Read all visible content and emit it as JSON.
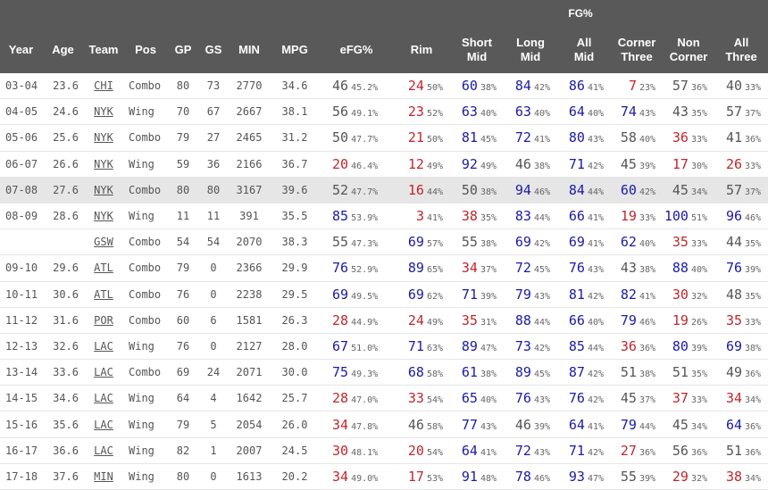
{
  "header": {
    "group_label": "FG%",
    "columns": [
      "Year",
      "Age",
      "Team",
      "Pos",
      "GP",
      "GS",
      "MIN",
      "MPG",
      "eFG%",
      "Rim",
      "Short\nMid",
      "Long\nMid",
      "All\nMid",
      "Corner\nThree",
      "Non\nCorner",
      "All\nThree"
    ]
  },
  "colors": {
    "high": "#1a1aa6",
    "low": "#c0262c",
    "mid": "#555555",
    "header_bg": "#595959",
    "highlight_row": "#e6e6e6"
  },
  "rows": [
    {
      "year": "03-04",
      "age": "23.6",
      "team": "CHI",
      "pos": "Combo",
      "gp": "80",
      "gs": "73",
      "min": "2770",
      "mpg": "34.6",
      "efg": [
        "46",
        "45.2%"
      ],
      "rim": [
        "24",
        "50%"
      ],
      "short_mid": [
        "60",
        "38%"
      ],
      "long_mid": [
        "84",
        "42%"
      ],
      "all_mid": [
        "86",
        "41%"
      ],
      "corner3": [
        "7",
        "23%"
      ],
      "noncorner": [
        "57",
        "36%"
      ],
      "all3": [
        "40",
        "33%"
      ]
    },
    {
      "year": "04-05",
      "age": "24.6",
      "team": "NYK",
      "pos": "Wing",
      "gp": "70",
      "gs": "67",
      "min": "2667",
      "mpg": "38.1",
      "efg": [
        "56",
        "49.1%"
      ],
      "rim": [
        "23",
        "52%"
      ],
      "short_mid": [
        "63",
        "40%"
      ],
      "long_mid": [
        "63",
        "40%"
      ],
      "all_mid": [
        "64",
        "40%"
      ],
      "corner3": [
        "74",
        "43%"
      ],
      "noncorner": [
        "43",
        "35%"
      ],
      "all3": [
        "57",
        "37%"
      ]
    },
    {
      "year": "05-06",
      "age": "25.6",
      "team": "NYK",
      "pos": "Combo",
      "gp": "79",
      "gs": "27",
      "min": "2465",
      "mpg": "31.2",
      "efg": [
        "50",
        "47.7%"
      ],
      "rim": [
        "21",
        "50%"
      ],
      "short_mid": [
        "81",
        "45%"
      ],
      "long_mid": [
        "72",
        "41%"
      ],
      "all_mid": [
        "80",
        "43%"
      ],
      "corner3": [
        "58",
        "40%"
      ],
      "noncorner": [
        "36",
        "33%"
      ],
      "all3": [
        "41",
        "36%"
      ]
    },
    {
      "year": "06-07",
      "age": "26.6",
      "team": "NYK",
      "pos": "Wing",
      "gp": "59",
      "gs": "36",
      "min": "2166",
      "mpg": "36.7",
      "efg": [
        "20",
        "46.4%"
      ],
      "rim": [
        "12",
        "49%"
      ],
      "short_mid": [
        "92",
        "49%"
      ],
      "long_mid": [
        "46",
        "38%"
      ],
      "all_mid": [
        "71",
        "42%"
      ],
      "corner3": [
        "45",
        "39%"
      ],
      "noncorner": [
        "17",
        "30%"
      ],
      "all3": [
        "26",
        "33%"
      ]
    },
    {
      "year": "07-08",
      "age": "27.6",
      "team": "NYK",
      "pos": "Combo",
      "gp": "80",
      "gs": "80",
      "min": "3167",
      "mpg": "39.6",
      "efg": [
        "52",
        "47.7%"
      ],
      "rim": [
        "16",
        "44%"
      ],
      "short_mid": [
        "50",
        "38%"
      ],
      "long_mid": [
        "94",
        "46%"
      ],
      "all_mid": [
        "84",
        "44%"
      ],
      "corner3": [
        "60",
        "42%"
      ],
      "noncorner": [
        "45",
        "34%"
      ],
      "all3": [
        "57",
        "37%"
      ],
      "highlight": true
    },
    {
      "year": "08-09",
      "age": "28.6",
      "team": "NYK",
      "pos": "Wing",
      "gp": "11",
      "gs": "11",
      "min": "391",
      "mpg": "35.5",
      "efg": [
        "85",
        "53.9%"
      ],
      "rim": [
        "3",
        "41%"
      ],
      "short_mid": [
        "38",
        "35%"
      ],
      "long_mid": [
        "83",
        "44%"
      ],
      "all_mid": [
        "66",
        "41%"
      ],
      "corner3": [
        "19",
        "33%"
      ],
      "noncorner": [
        "100",
        "51%"
      ],
      "all3": [
        "96",
        "46%"
      ]
    },
    {
      "year": "",
      "age": "",
      "team": "GSW",
      "pos": "Combo",
      "gp": "54",
      "gs": "54",
      "min": "2070",
      "mpg": "38.3",
      "efg": [
        "55",
        "47.3%"
      ],
      "rim": [
        "69",
        "57%"
      ],
      "short_mid": [
        "55",
        "38%"
      ],
      "long_mid": [
        "69",
        "42%"
      ],
      "all_mid": [
        "69",
        "41%"
      ],
      "corner3": [
        "62",
        "40%"
      ],
      "noncorner": [
        "35",
        "33%"
      ],
      "all3": [
        "44",
        "35%"
      ]
    },
    {
      "year": "09-10",
      "age": "29.6",
      "team": "ATL",
      "pos": "Combo",
      "gp": "79",
      "gs": "0",
      "min": "2366",
      "mpg": "29.9",
      "efg": [
        "76",
        "52.9%"
      ],
      "rim": [
        "89",
        "65%"
      ],
      "short_mid": [
        "34",
        "37%"
      ],
      "long_mid": [
        "72",
        "45%"
      ],
      "all_mid": [
        "76",
        "43%"
      ],
      "corner3": [
        "43",
        "38%"
      ],
      "noncorner": [
        "88",
        "40%"
      ],
      "all3": [
        "76",
        "39%"
      ]
    },
    {
      "year": "10-11",
      "age": "30.6",
      "team": "ATL",
      "pos": "Combo",
      "gp": "76",
      "gs": "0",
      "min": "2238",
      "mpg": "29.5",
      "efg": [
        "69",
        "49.5%"
      ],
      "rim": [
        "69",
        "62%"
      ],
      "short_mid": [
        "71",
        "39%"
      ],
      "long_mid": [
        "79",
        "43%"
      ],
      "all_mid": [
        "81",
        "42%"
      ],
      "corner3": [
        "82",
        "41%"
      ],
      "noncorner": [
        "30",
        "32%"
      ],
      "all3": [
        "48",
        "35%"
      ]
    },
    {
      "year": "11-12",
      "age": "31.6",
      "team": "POR",
      "pos": "Combo",
      "gp": "60",
      "gs": "6",
      "min": "1581",
      "mpg": "26.3",
      "efg": [
        "28",
        "44.9%"
      ],
      "rim": [
        "24",
        "49%"
      ],
      "short_mid": [
        "35",
        "31%"
      ],
      "long_mid": [
        "88",
        "44%"
      ],
      "all_mid": [
        "66",
        "40%"
      ],
      "corner3": [
        "79",
        "46%"
      ],
      "noncorner": [
        "19",
        "26%"
      ],
      "all3": [
        "35",
        "33%"
      ]
    },
    {
      "year": "12-13",
      "age": "32.6",
      "team": "LAC",
      "pos": "Wing",
      "gp": "76",
      "gs": "0",
      "min": "2127",
      "mpg": "28.0",
      "efg": [
        "67",
        "51.0%"
      ],
      "rim": [
        "71",
        "63%"
      ],
      "short_mid": [
        "89",
        "47%"
      ],
      "long_mid": [
        "73",
        "42%"
      ],
      "all_mid": [
        "85",
        "44%"
      ],
      "corner3": [
        "36",
        "36%"
      ],
      "noncorner": [
        "80",
        "39%"
      ],
      "all3": [
        "69",
        "38%"
      ]
    },
    {
      "year": "13-14",
      "age": "33.6",
      "team": "LAC",
      "pos": "Combo",
      "gp": "69",
      "gs": "24",
      "min": "2071",
      "mpg": "30.0",
      "efg": [
        "75",
        "49.3%"
      ],
      "rim": [
        "68",
        "58%"
      ],
      "short_mid": [
        "61",
        "38%"
      ],
      "long_mid": [
        "89",
        "45%"
      ],
      "all_mid": [
        "87",
        "42%"
      ],
      "corner3": [
        "51",
        "38%"
      ],
      "noncorner": [
        "51",
        "35%"
      ],
      "all3": [
        "49",
        "36%"
      ]
    },
    {
      "year": "14-15",
      "age": "34.6",
      "team": "LAC",
      "pos": "Wing",
      "gp": "64",
      "gs": "4",
      "min": "1642",
      "mpg": "25.7",
      "efg": [
        "28",
        "47.0%"
      ],
      "rim": [
        "33",
        "54%"
      ],
      "short_mid": [
        "65",
        "40%"
      ],
      "long_mid": [
        "76",
        "43%"
      ],
      "all_mid": [
        "76",
        "42%"
      ],
      "corner3": [
        "45",
        "37%"
      ],
      "noncorner": [
        "37",
        "33%"
      ],
      "all3": [
        "34",
        "34%"
      ]
    },
    {
      "year": "15-16",
      "age": "35.6",
      "team": "LAC",
      "pos": "Wing",
      "gp": "79",
      "gs": "5",
      "min": "2054",
      "mpg": "26.0",
      "efg": [
        "34",
        "47.8%"
      ],
      "rim": [
        "46",
        "58%"
      ],
      "short_mid": [
        "77",
        "43%"
      ],
      "long_mid": [
        "46",
        "39%"
      ],
      "all_mid": [
        "64",
        "41%"
      ],
      "corner3": [
        "79",
        "44%"
      ],
      "noncorner": [
        "45",
        "34%"
      ],
      "all3": [
        "64",
        "36%"
      ]
    },
    {
      "year": "16-17",
      "age": "36.6",
      "team": "LAC",
      "pos": "Wing",
      "gp": "82",
      "gs": "1",
      "min": "2007",
      "mpg": "24.5",
      "efg": [
        "30",
        "48.1%"
      ],
      "rim": [
        "20",
        "54%"
      ],
      "short_mid": [
        "64",
        "41%"
      ],
      "long_mid": [
        "72",
        "43%"
      ],
      "all_mid": [
        "71",
        "42%"
      ],
      "corner3": [
        "27",
        "36%"
      ],
      "noncorner": [
        "56",
        "36%"
      ],
      "all3": [
        "51",
        "36%"
      ]
    },
    {
      "year": "17-18",
      "age": "37.6",
      "team": "MIN",
      "pos": "Wing",
      "gp": "80",
      "gs": "0",
      "min": "1613",
      "mpg": "20.2",
      "efg": [
        "34",
        "49.0%"
      ],
      "rim": [
        "17",
        "53%"
      ],
      "short_mid": [
        "91",
        "48%"
      ],
      "long_mid": [
        "78",
        "46%"
      ],
      "all_mid": [
        "93",
        "47%"
      ],
      "corner3": [
        "55",
        "39%"
      ],
      "noncorner": [
        "29",
        "32%"
      ],
      "all3": [
        "38",
        "34%"
      ]
    }
  ]
}
